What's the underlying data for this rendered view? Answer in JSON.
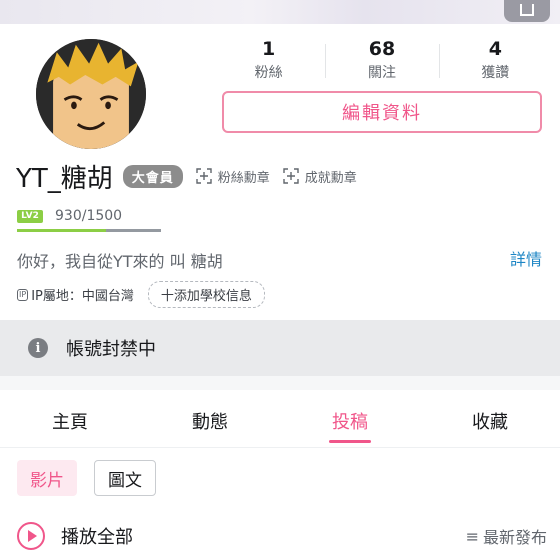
{
  "stats": [
    {
      "value": "1",
      "label": "粉絲"
    },
    {
      "value": "68",
      "label": "關注"
    },
    {
      "value": "4",
      "label": "獲讚"
    }
  ],
  "edit_button": "編輯資料",
  "profile": {
    "username": "YT_糖胡",
    "vip_badge": "大會員",
    "fan_medal": "粉絲勳章",
    "achievement_medal": "成就勳章",
    "level_badge": "LV2",
    "level_progress_text": "930/1500",
    "level_progress": 0.62,
    "bio": "你好，我自從YT來的 叫 糖胡",
    "details": "詳情",
    "ip_icon": "IP",
    "ip_location": "IP屬地：中國台灣",
    "add_school": "十添加學校信息"
  },
  "ban_notice": "帳號封禁中",
  "tabs": [
    {
      "label": "主頁",
      "active": false
    },
    {
      "label": "動態",
      "active": false
    },
    {
      "label": "投稿",
      "active": true
    },
    {
      "label": "收藏",
      "active": false
    }
  ],
  "filters": [
    {
      "label": "影片",
      "active": true
    },
    {
      "label": "圖文",
      "active": false
    }
  ],
  "play_all": "播放全部",
  "sort": {
    "icon": "≡",
    "label": "最新發布"
  },
  "colors": {
    "accent": "#f0568a",
    "link": "#1e86c5",
    "level": "#8cce45"
  }
}
